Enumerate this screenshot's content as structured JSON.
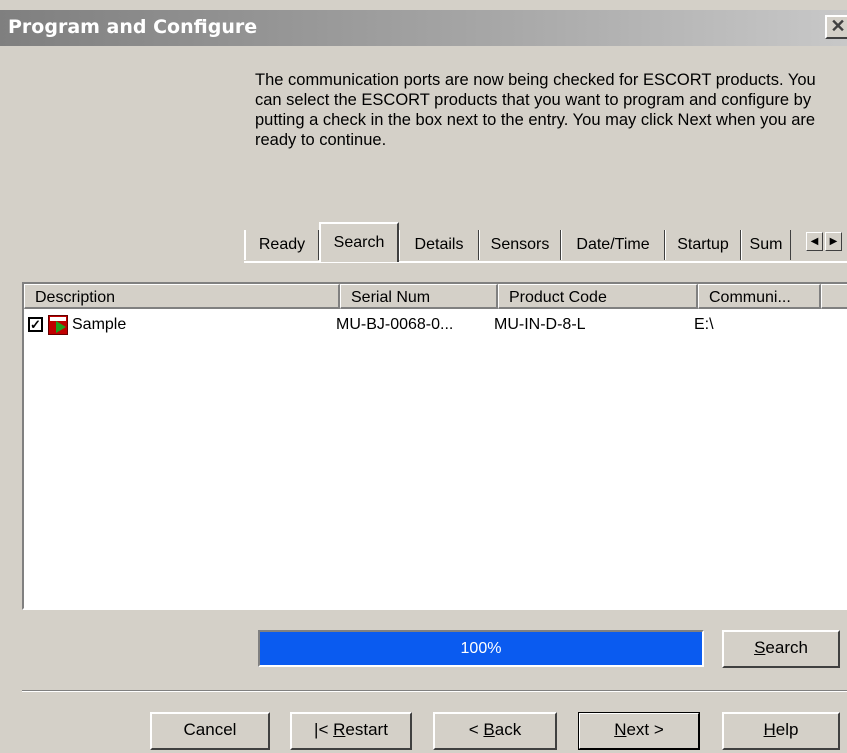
{
  "window": {
    "title": "Program and Configure",
    "close_glyph": "✕"
  },
  "intro_text": "The communication ports are now being checked for ESCORT products. You can select the ESCORT products that you want to program and configure by putting a check in the box next to the entry. You may click Next when you are ready to continue.",
  "tabs": [
    {
      "label": "Ready"
    },
    {
      "label": "Search",
      "active": true
    },
    {
      "label": "Details"
    },
    {
      "label": "Sensors"
    },
    {
      "label": "Date/Time"
    },
    {
      "label": "Startup"
    },
    {
      "label": "Sum"
    }
  ],
  "tab_scroll": {
    "left_glyph": "◀",
    "right_glyph": "▶"
  },
  "list": {
    "columns": [
      "Description",
      "Serial Num",
      "Product Code",
      "Communi..."
    ],
    "rows": [
      {
        "checked": true,
        "check_glyph": "✓",
        "icon": "escort-device-icon",
        "description": "Sample",
        "serial": "MU-BJ-0068-0...",
        "product_code": "MU-IN-D-8-L",
        "comm": "E:\\"
      }
    ]
  },
  "progress": {
    "value_percent": 100,
    "label": "100%"
  },
  "buttons": {
    "search": {
      "pre": "",
      "mnemonic": "S",
      "post": "earch"
    },
    "cancel": {
      "label": "Cancel"
    },
    "restart": {
      "pre": "|< ",
      "mnemonic": "R",
      "post": "estart"
    },
    "back": {
      "pre": "< ",
      "mnemonic": "B",
      "post": "ack"
    },
    "next": {
      "pre": "",
      "mnemonic": "N",
      "post": "ext >"
    },
    "help": {
      "pre": "",
      "mnemonic": "H",
      "post": "elp"
    }
  },
  "colors": {
    "progress_fill": "#0a5bf0",
    "dialog_bg": "#d4d0c8"
  }
}
